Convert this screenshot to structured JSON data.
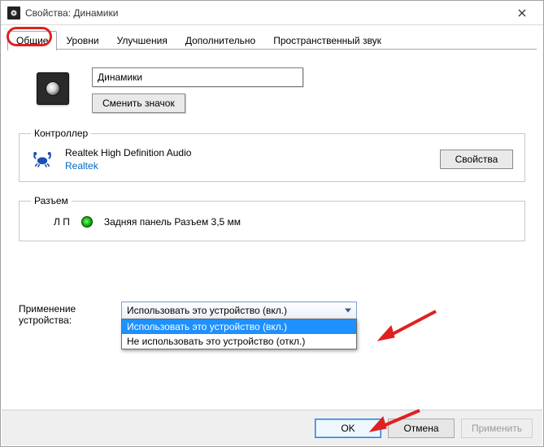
{
  "window": {
    "title": "Свойства: Динамики"
  },
  "tabs": [
    {
      "label": "Общие",
      "active": true
    },
    {
      "label": "Уровни"
    },
    {
      "label": "Улучшения"
    },
    {
      "label": "Дополнительно"
    },
    {
      "label": "Пространственный звук"
    }
  ],
  "device": {
    "name_value": "Динамики",
    "change_icon_label": "Сменить значок"
  },
  "controller": {
    "group_title": "Контроллер",
    "name": "Realtek High Definition Audio",
    "vendor": "Realtek",
    "properties_label": "Свойства"
  },
  "jack": {
    "group_title": "Разъем",
    "channel": "Л П",
    "description": "Задняя панель Разъем 3,5 мм",
    "color": "#0eaa0e"
  },
  "usage": {
    "label": "Применение устройства:",
    "selected": "Использовать это устройство (вкл.)",
    "options": [
      "Использовать это устройство (вкл.)",
      "Не использовать это устройство (откл.)"
    ]
  },
  "footer": {
    "ok": "OK",
    "cancel": "Отмена",
    "apply": "Применить"
  }
}
